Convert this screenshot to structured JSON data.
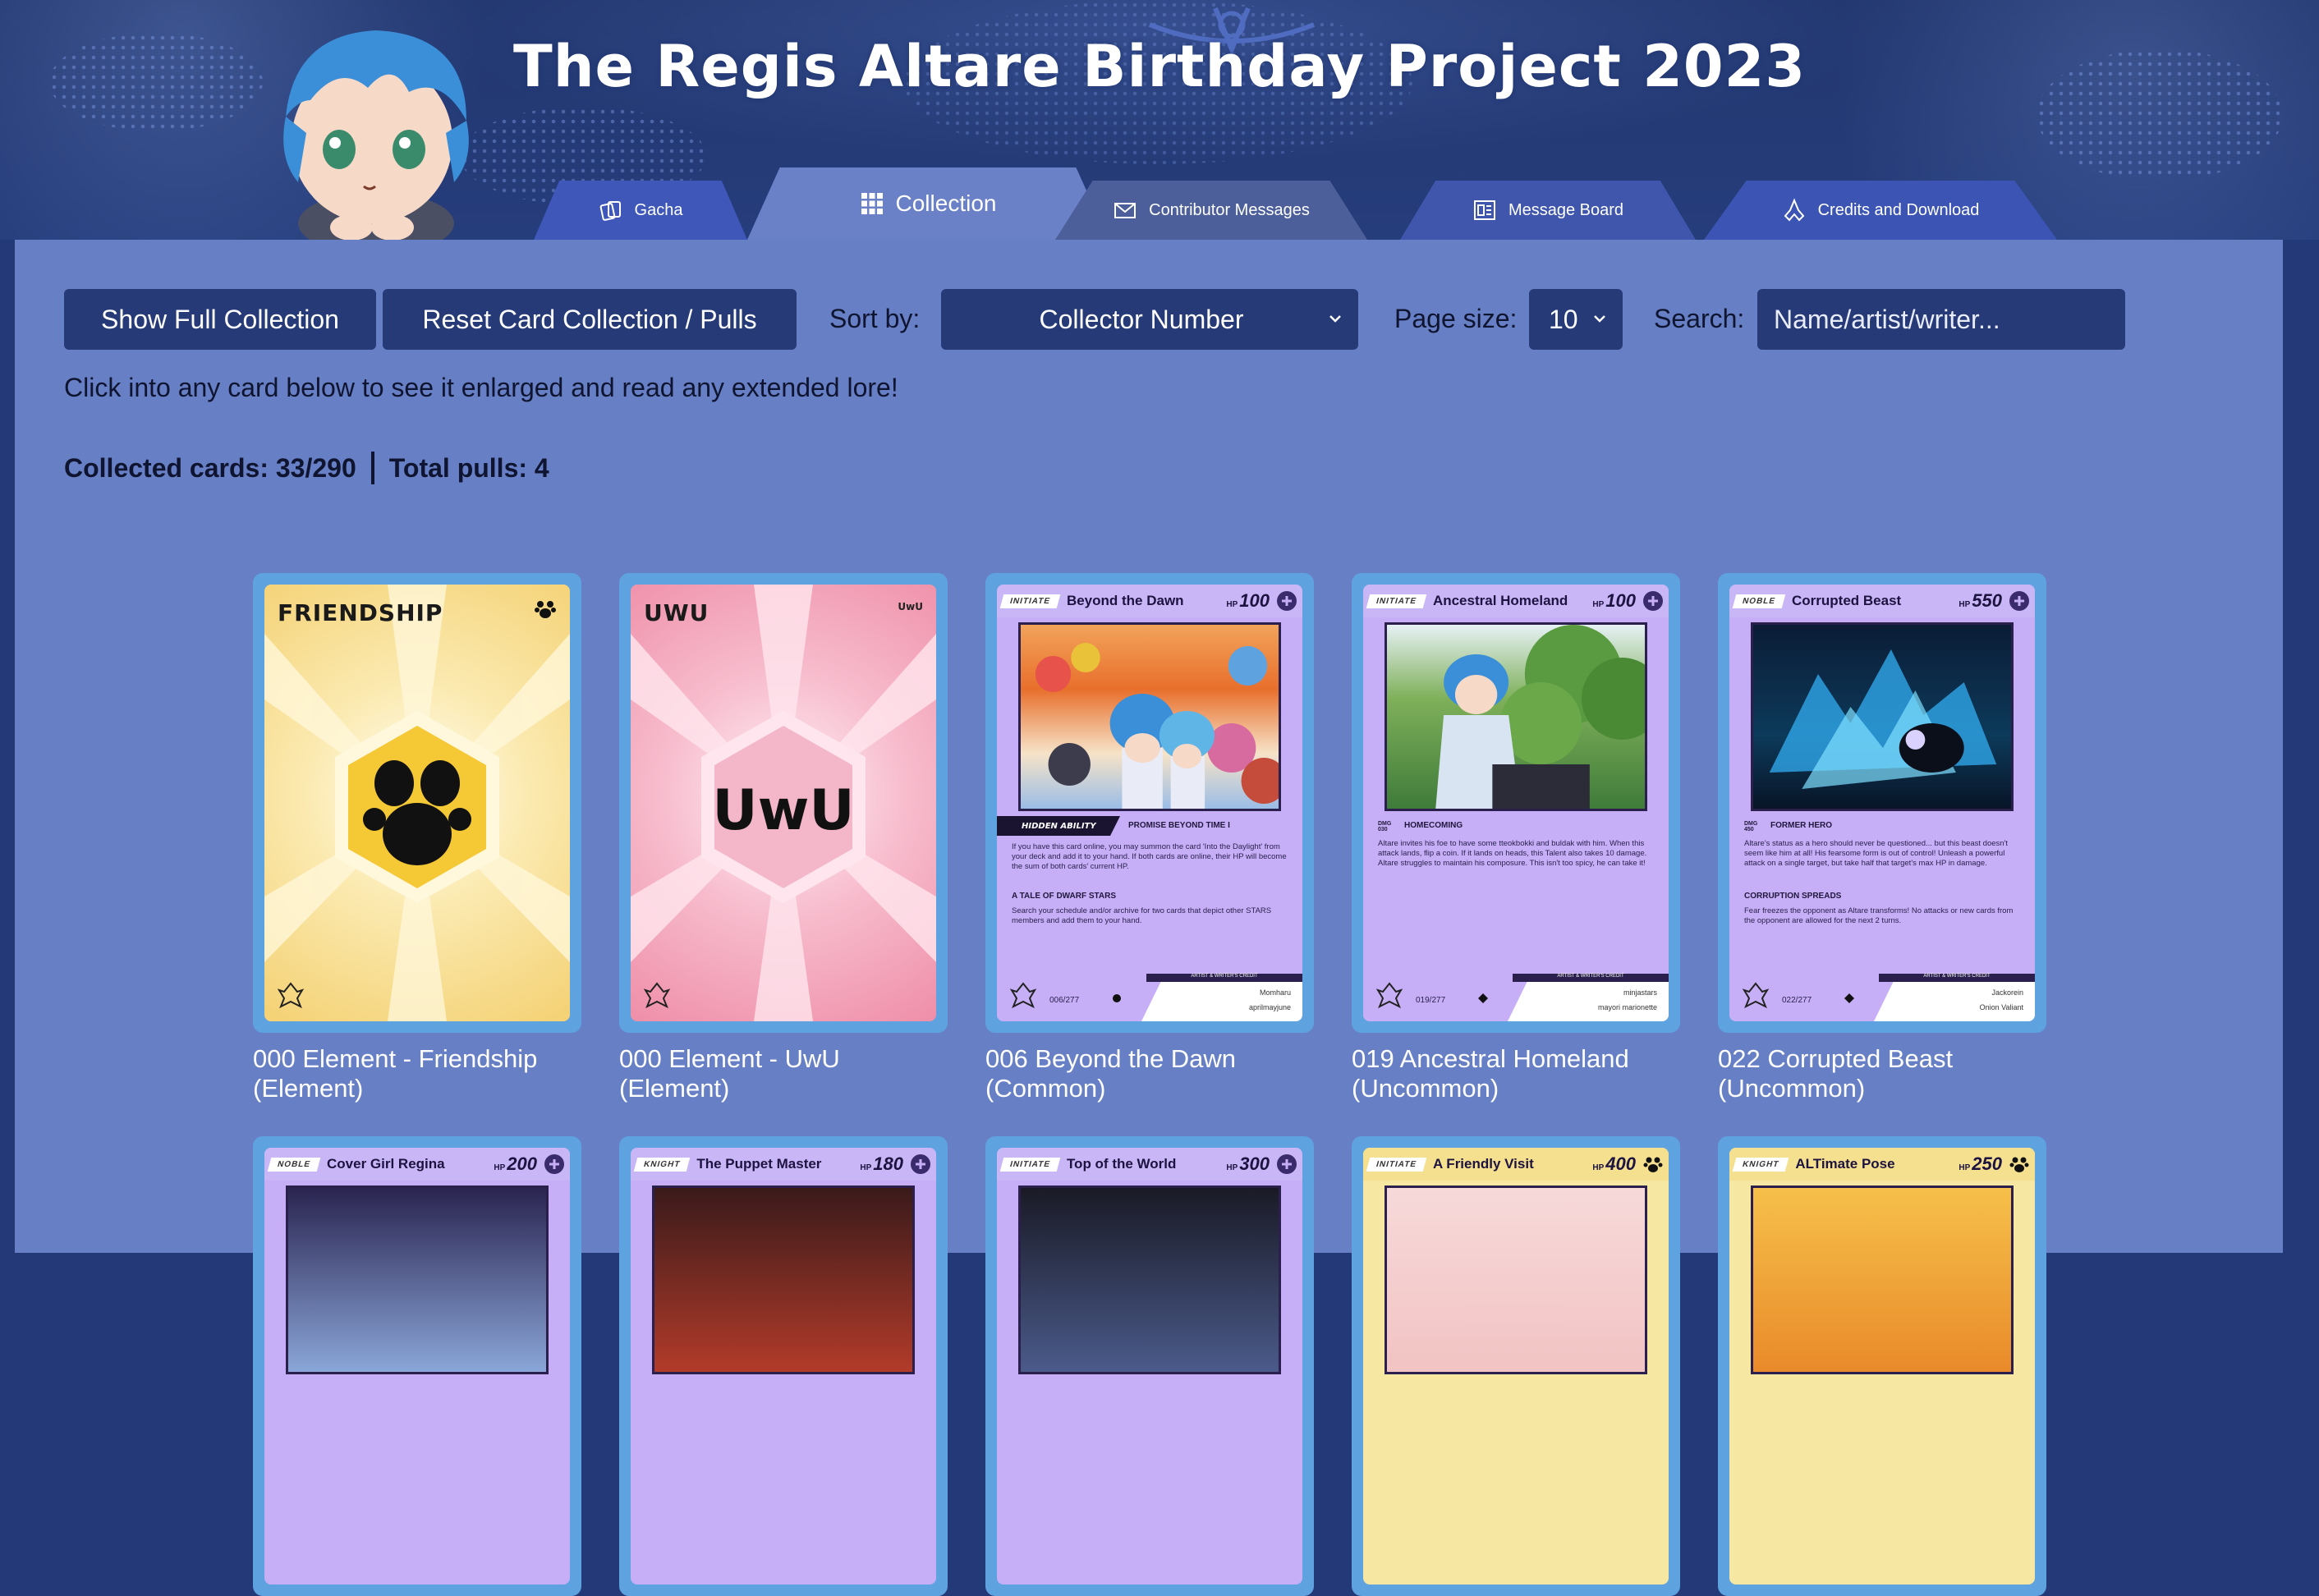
{
  "site": {
    "title": "The Regis Altare Birthday Project 2023"
  },
  "nav": {
    "tabs": [
      {
        "label": "Gacha",
        "icon": "cards-icon"
      },
      {
        "label": "Collection",
        "icon": "grid-icon",
        "active": true
      },
      {
        "label": "Contributor Messages",
        "icon": "envelope-icon"
      },
      {
        "label": "Message Board",
        "icon": "board-icon"
      },
      {
        "label": "Credits and Download",
        "icon": "hands-icon"
      }
    ]
  },
  "toolbar": {
    "show_full_label": "Show Full Collection",
    "reset_label": "Reset Card Collection / Pulls",
    "sort_label": "Sort by:",
    "sort_value": "Collector Number",
    "page_size_label": "Page size:",
    "page_size_value": "10",
    "search_label": "Search:",
    "search_placeholder": "Name/artist/writer..."
  },
  "hint": "Click into any card below to see it enlarged and read any extended lore!",
  "stats": {
    "collected": "Collected cards: 33/290",
    "pulls": "Total pulls: 4"
  },
  "colors": {
    "header_bg": "#243a78",
    "panel_bg": "#677fc4",
    "button_bg": "#263a78",
    "card_border": "#5fa2e0",
    "purple_card": "#c6aff6",
    "yellow_card": "#f6e7a3"
  },
  "cards": [
    {
      "caption1": "000 Element - Friendship",
      "caption2": "(Element)",
      "title": "FRIENDSHIP",
      "icon": "paw-icon"
    },
    {
      "caption1": "000 Element - UwU",
      "caption2": "(Element)",
      "title": "UWU",
      "corner": "UwU",
      "center": "UwU"
    },
    {
      "caption1": "006 Beyond the Dawn",
      "caption2": "(Common)",
      "rank": "INITIATE",
      "name": "Beyond the Dawn",
      "hp_prefix": "HP",
      "hp": "100",
      "hidden_ability": "HIDDEN ABILITY",
      "ability1": "PROMISE BEYOND TIME I",
      "text1": "If you have this card online, you may summon the card 'Into the Daylight' from your deck and add it to your hand. If both cards are online, their HP will become the sum of both cards' current HP.",
      "ability2": "A TALE OF DWARF STARS",
      "text2": "Search your schedule and/or archive for two cards that depict other STARS members and add them to your hand.",
      "number": "006/277",
      "credit_head": "ARTIST & WRITER'S CREDIT",
      "artist": "Momharu",
      "writer": "aprilmayjune"
    },
    {
      "caption1": "019 Ancestral Homeland",
      "caption2": "(Uncommon)",
      "rank": "INITIATE",
      "name": "Ancestral Homeland",
      "hp_prefix": "HP",
      "hp": "100",
      "dmg_label": "DMG",
      "dmg": "030",
      "ability1": "HOMECOMING",
      "text1": "Altare invites his foe to have some tteokbokki and buldak with him. When this attack lands, flip a coin. If it lands on heads, this Talent also takes 10 damage. Altare struggles to maintain his composure. This isn't too spicy, he can take it!",
      "number": "019/277",
      "credit_head": "ARTIST & WRITER'S CREDIT",
      "artist": "minjastars",
      "writer": "mayori marionette"
    },
    {
      "caption1": "022 Corrupted Beast",
      "caption2": "(Uncommon)",
      "rank": "NOBLE",
      "name": "Corrupted Beast",
      "hp_prefix": "HP",
      "hp": "550",
      "dmg_label": "DMG",
      "dmg": "450",
      "ability1": "FORMER HERO",
      "text1": "Altare's status as a hero should never be questioned... but this beast doesn't seem like him at all! His fearsome form is out of control! Unleash a powerful attack on a single target, but take half that target's max HP in damage.",
      "ability2": "CORRUPTION SPREADS",
      "text2": "Fear freezes the opponent as Altare transforms! No attacks or new cards from the opponent are allowed for the next 2 turns.",
      "number": "022/277",
      "credit_head": "ARTIST & WRITER'S CREDIT",
      "artist": "Jackorein",
      "writer": "Onion Valiant"
    },
    {
      "rank": "NOBLE",
      "name": "Cover Girl Regina",
      "hp_prefix": "HP",
      "hp": "200"
    },
    {
      "rank": "KNIGHT",
      "name": "The Puppet Master",
      "hp_prefix": "HP",
      "hp": "180"
    },
    {
      "rank": "INITIATE",
      "name": "Top of the World",
      "hp_prefix": "HP",
      "hp": "300"
    },
    {
      "rank": "INITIATE",
      "name": "A Friendly Visit",
      "hp_prefix": "HP",
      "hp": "400"
    },
    {
      "rank": "KNIGHT",
      "name": "ALTimate Pose",
      "hp_prefix": "HP",
      "hp": "250"
    }
  ]
}
